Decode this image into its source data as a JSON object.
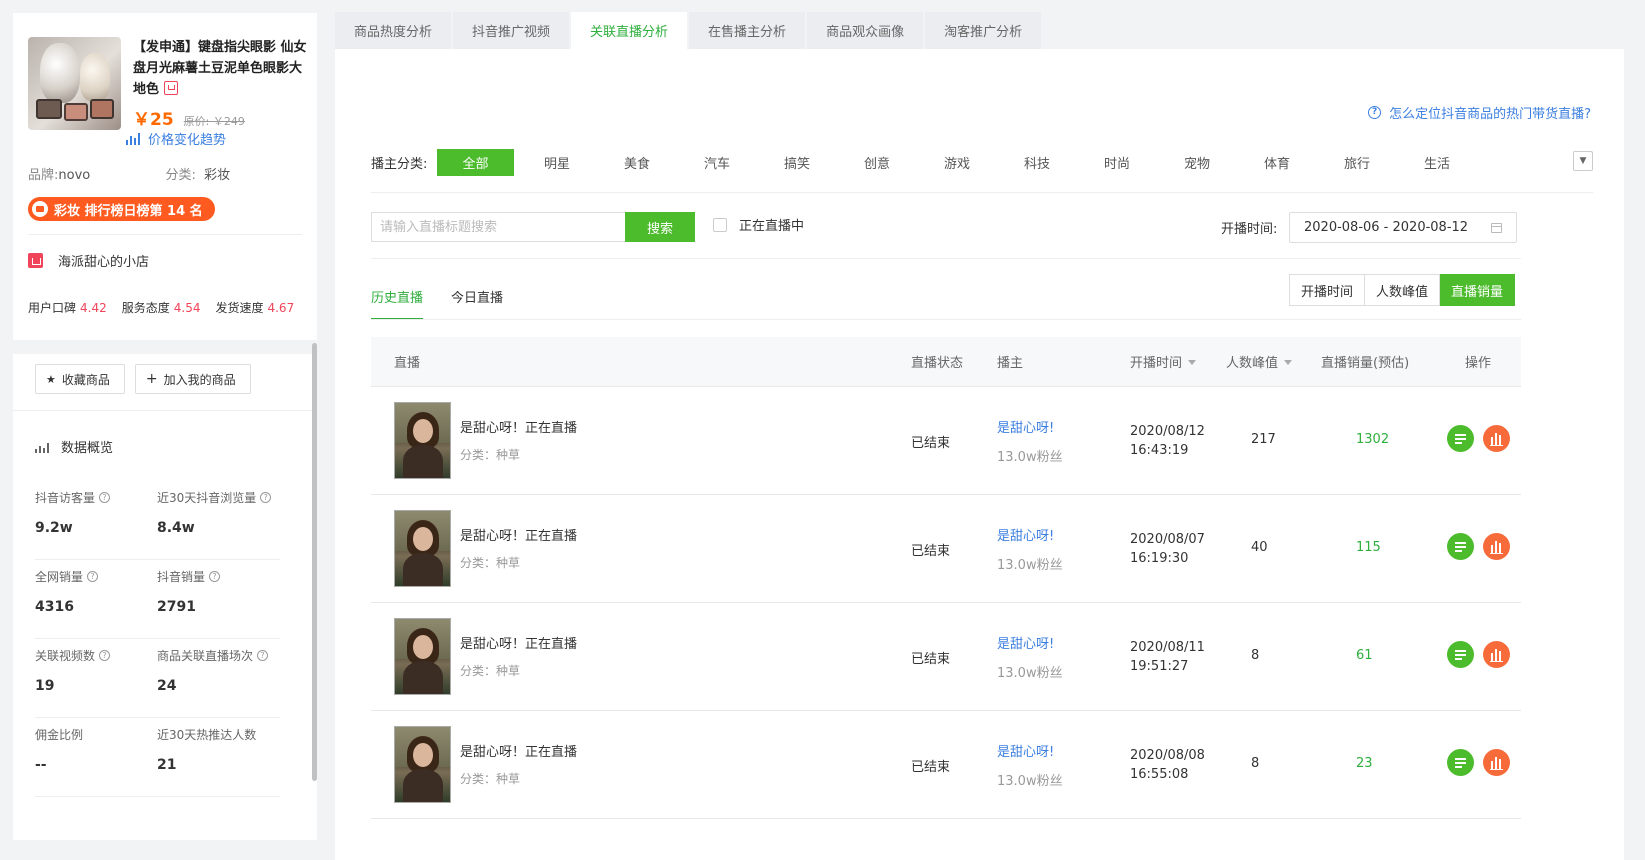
{
  "product": {
    "title": "【发申通】键盘指尖眼影 仙女盘月光麻薯土豆泥单色眼影大地色",
    "price": "￥25",
    "original_price": "原价: ￥249",
    "trend_link": "价格变化趋势",
    "brand_label": "品牌:",
    "brand_value": "novo",
    "category_label": "分类:",
    "category_value": "彩妆",
    "rank_badge": "彩妆 排行榜日榜第 14 名",
    "shop_name": "海派甜心的小店",
    "scores": [
      {
        "label": "用户口碑",
        "value": "4.42"
      },
      {
        "label": "服务态度",
        "value": "4.54"
      },
      {
        "label": "发货速度",
        "value": "4.67"
      }
    ],
    "btn_favorite": "收藏商品",
    "btn_add": "加入我的商品",
    "overview_title": "数据概览",
    "stats": [
      {
        "label": "抖音访客量",
        "value": "9.2w",
        "help": true
      },
      {
        "label": "近30天抖音浏览量",
        "value": "8.4w",
        "help": true
      },
      {
        "label": "全网销量",
        "value": "4316",
        "help": true
      },
      {
        "label": "抖音销量",
        "value": "2791",
        "help": true
      },
      {
        "label": "关联视频数",
        "value": "19",
        "help": true
      },
      {
        "label": "商品关联直播场次",
        "value": "24",
        "help": true
      },
      {
        "label": "佣金比例",
        "value": "--",
        "help": false
      },
      {
        "label": "近30天热推达人数",
        "value": "21",
        "help": false
      }
    ]
  },
  "tabs": [
    "商品热度分析",
    "抖音推广视频",
    "关联直播分析",
    "在售播主分析",
    "商品观众画像",
    "淘客推广分析"
  ],
  "active_tab": 2,
  "help_link": "怎么定位抖音商品的热门带货直播?",
  "category_filter": {
    "label": "播主分类:",
    "items": [
      "全部",
      "明星",
      "美食",
      "汽车",
      "搞笑",
      "创意",
      "游戏",
      "科技",
      "时尚",
      "宠物",
      "体育",
      "旅行",
      "生活"
    ]
  },
  "search": {
    "placeholder": "请输入直播标题搜索",
    "button": "搜索",
    "live_checkbox": "正在直播中",
    "date_label": "开播时间:",
    "date_value": "2020-08-06 - 2020-08-12"
  },
  "sub_tabs": [
    "历史直播",
    "今日直播"
  ],
  "sort_buttons": [
    "开播时间",
    "人数峰值",
    "直播销量"
  ],
  "table": {
    "headers": {
      "live": "直播",
      "status": "直播状态",
      "anchor": "播主",
      "time": "开播时间",
      "peak": "人数峰值",
      "sales": "直播销量(预估)",
      "ops": "操作"
    },
    "rows": [
      {
        "title": "是甜心呀！正在直播",
        "category": "分类：种草",
        "status": "已结束",
        "anchor": "是甜心呀!",
        "fans": "13.0w粉丝",
        "date": "2020/08/12",
        "clock": "16:43:19",
        "peak": "217",
        "sales": "1302"
      },
      {
        "title": "是甜心呀！正在直播",
        "category": "分类：种草",
        "status": "已结束",
        "anchor": "是甜心呀!",
        "fans": "13.0w粉丝",
        "date": "2020/08/07",
        "clock": "16:19:30",
        "peak": "40",
        "sales": "115"
      },
      {
        "title": "是甜心呀！正在直播",
        "category": "分类：种草",
        "status": "已结束",
        "anchor": "是甜心呀!",
        "fans": "13.0w粉丝",
        "date": "2020/08/11",
        "clock": "19:51:27",
        "peak": "8",
        "sales": "61"
      },
      {
        "title": "是甜心呀！正在直播",
        "category": "分类：种草",
        "status": "已结束",
        "anchor": "是甜心呀!",
        "fans": "13.0w粉丝",
        "date": "2020/08/08",
        "clock": "16:55:08",
        "peak": "8",
        "sales": "23"
      }
    ]
  },
  "colors": {
    "accent": "#4cbb2c",
    "link": "#3b7fe0",
    "price": "#ff6a00",
    "danger": "#f0445a"
  }
}
